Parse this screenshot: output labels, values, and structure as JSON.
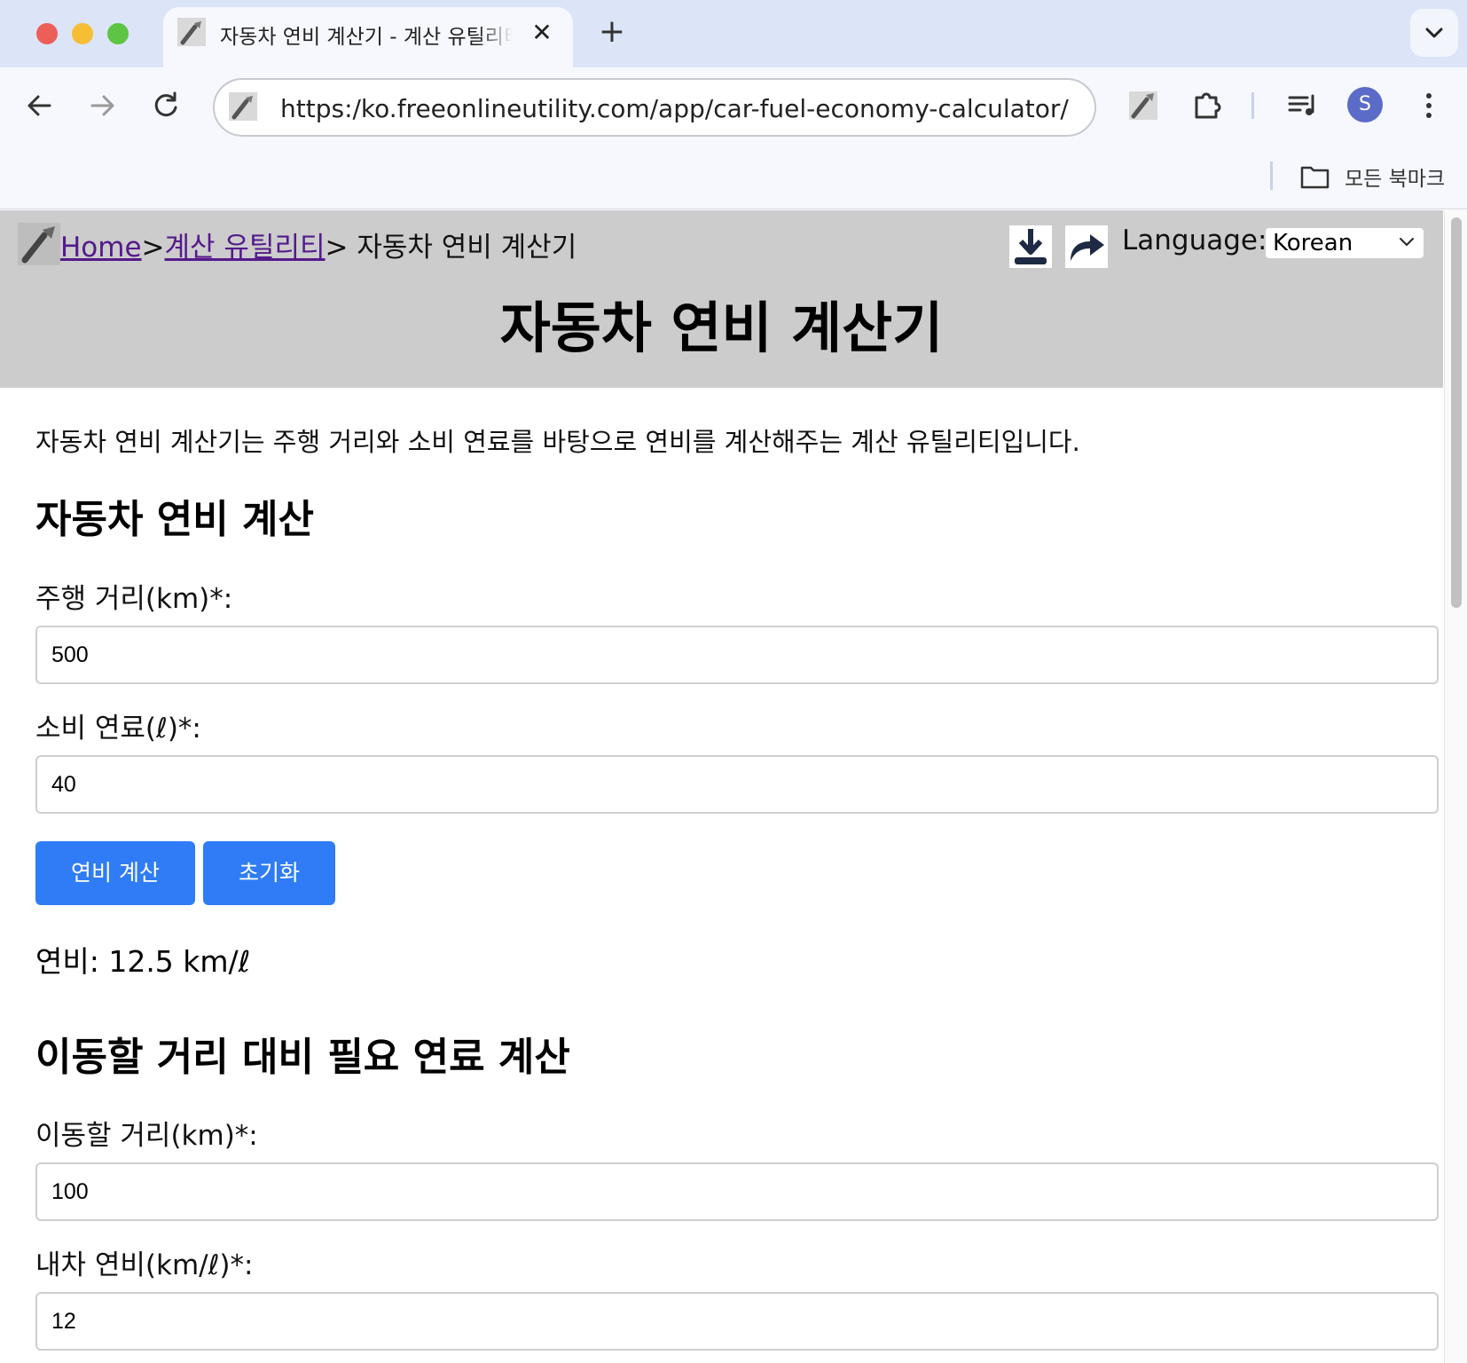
{
  "browser": {
    "tab_title": "자동차 연비 계산기 - 계산 유틸리티",
    "tab_close": "✕",
    "new_tab": "+",
    "url": "https:/ko.freeonlineutility.com/app/car-fuel-economy-calculator/",
    "profile_initial": "S",
    "bookmarks_label": "모든 북마크"
  },
  "header": {
    "breadcrumb": {
      "home": "Home",
      "sep1": ">",
      "category": "계산 유틸리티",
      "sep2": ">",
      "current": " 자동차 연비 계산기"
    },
    "language_label": "Language:",
    "language_value": "Korean",
    "title": "자동차 연비 계산기"
  },
  "intro": "자동차 연비 계산기는 주행 거리와 소비 연료를 바탕으로 연비를 계산해주는 계산 유틸리티입니다.",
  "section1": {
    "heading": "자동차 연비 계산",
    "distance_label": "주행 거리(km)*:",
    "distance_value": "500",
    "fuel_label": "소비 연료(ℓ)*:",
    "fuel_value": "40",
    "calc_button": "연비 계산",
    "reset_button": "초기화",
    "result": "연비: 12.5 km/ℓ"
  },
  "section2": {
    "heading": "이동할 거리 대비 필요 연료 계산",
    "distance_label": "이동할 거리(km)*:",
    "distance_value": "100",
    "economy_label": "내차 연비(km/ℓ)*:",
    "economy_value": "12"
  },
  "colors": {
    "header_bg": "#cccccc",
    "button_bg": "#2f7cf6",
    "link": "#551a8b",
    "tabstrip_bg": "#dce5f7"
  }
}
